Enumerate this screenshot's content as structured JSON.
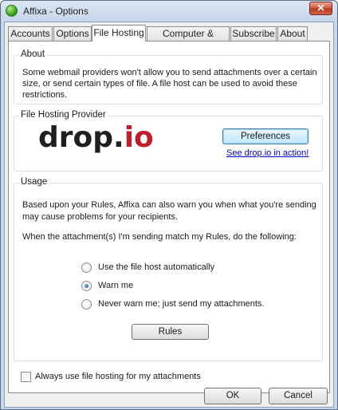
{
  "window": {
    "title": "Affixa - Options",
    "close_glyph": "✕"
  },
  "tabs": [
    {
      "label": "Accounts"
    },
    {
      "label": "Options"
    },
    {
      "label": "File Hosting",
      "active": true
    },
    {
      "label": "Computer & Internet"
    },
    {
      "label": "Subscribe"
    },
    {
      "label": "About"
    }
  ],
  "about": {
    "title": "About",
    "text": "Some webmail providers won't allow you to send attachments over a certain size, or send certain types of file. A file host can be used to avoid these restrictions."
  },
  "provider": {
    "title": "File Hosting Provider",
    "logo_main": "drop.",
    "logo_accent": "io",
    "preferences_label": "Preferences",
    "link_text": "See drop.io in action!",
    "logo_accent_color": "#c01c2c"
  },
  "usage": {
    "title": "Usage",
    "intro": "Based upon your Rules, Affixa can also warn you when what you're sending may cause problems for your recipients.",
    "instruction": "When the attachment(s) I'm sending match my Rules, do the following:",
    "options": [
      {
        "label": "Use the file host automatically",
        "checked": false
      },
      {
        "label": "Warn me",
        "checked": true
      },
      {
        "label": "Never warn me; just send my attachments.",
        "checked": false
      }
    ],
    "rules_label": "Rules"
  },
  "always_use": {
    "label": "Always use file hosting for my attachments",
    "checked": false
  },
  "footer": {
    "ok_label": "OK",
    "cancel_label": "Cancel"
  }
}
